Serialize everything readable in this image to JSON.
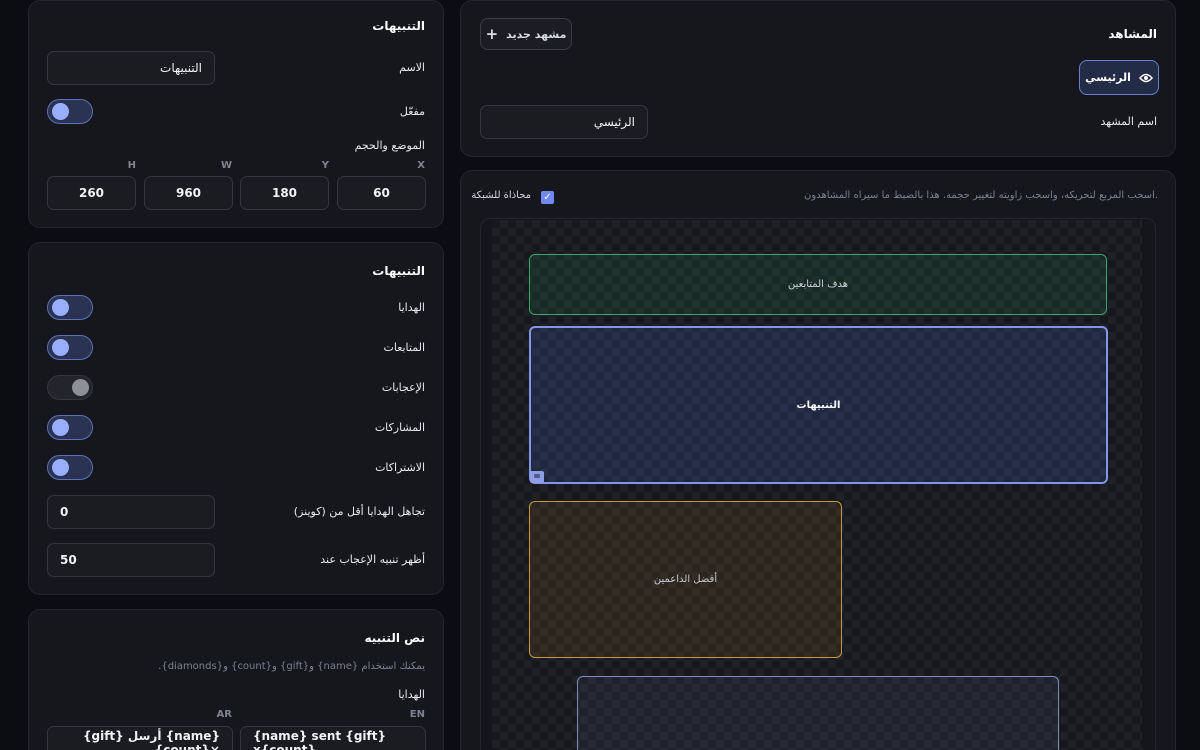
{
  "scenes_panel": {
    "title": "المشاهد",
    "new_scene_label": "مشهد جديد",
    "scene_tab_label": "الرئيسي",
    "scene_name_label": "اسم المشهد",
    "scene_name_value": "الرئيسي"
  },
  "editor": {
    "hint": "اسحب المربع لتحريكه، واسحب زاويته لتغيير حجمه. هذا بالضبط ما سيراه المشاهدون.",
    "snap_label": "محاذاة للشبكة",
    "snap_checked": true,
    "widgets": {
      "followers_goal": "هدف المتابعين",
      "alerts": "التنبيهات",
      "top_supporters": "أفضل الداعمين",
      "resize_glyph": "="
    }
  },
  "widget_settings": {
    "title": "التنبيهات",
    "name_label": "الاسم",
    "name_value": "التنبيهات",
    "enabled_label": "مفعّل",
    "enabled": true,
    "position_label": "الموضع والحجم",
    "coords": {
      "x_label": "X",
      "y_label": "Y",
      "w_label": "W",
      "h_label": "H",
      "x": "60",
      "y": "180",
      "w": "960",
      "h": "260"
    }
  },
  "alert_types": {
    "title": "التنبيهات",
    "items": [
      {
        "label": "الهدايا",
        "on": true
      },
      {
        "label": "المتابعات",
        "on": true
      },
      {
        "label": "الإعجابات",
        "on": false
      },
      {
        "label": "المشاركات",
        "on": true
      },
      {
        "label": "الاشتراكات",
        "on": true
      }
    ],
    "min_gift_label": "تجاهل الهدايا أقل من (كوينز)",
    "min_gift_value": "0",
    "like_threshold_label": "أظهر تنبيه الإعجاب عند",
    "like_threshold_value": "50"
  },
  "alert_text": {
    "title": "نص التنبيه",
    "hint": "يمكنك استخدام {name} و{gift} و{count} و{diamonds}.",
    "gifts_label": "الهدايا",
    "en_label": "EN",
    "ar_label": "AR",
    "en_value": "{name} sent {gift} x{count}",
    "ar_value": "{name} أرسل {gift} ×{count}"
  },
  "colors": {
    "accent": "#6f89f0",
    "toggle_knob_on": "#9aaeff",
    "goal_green": "#3ca56a",
    "supporters_orange": "#c9963c"
  }
}
